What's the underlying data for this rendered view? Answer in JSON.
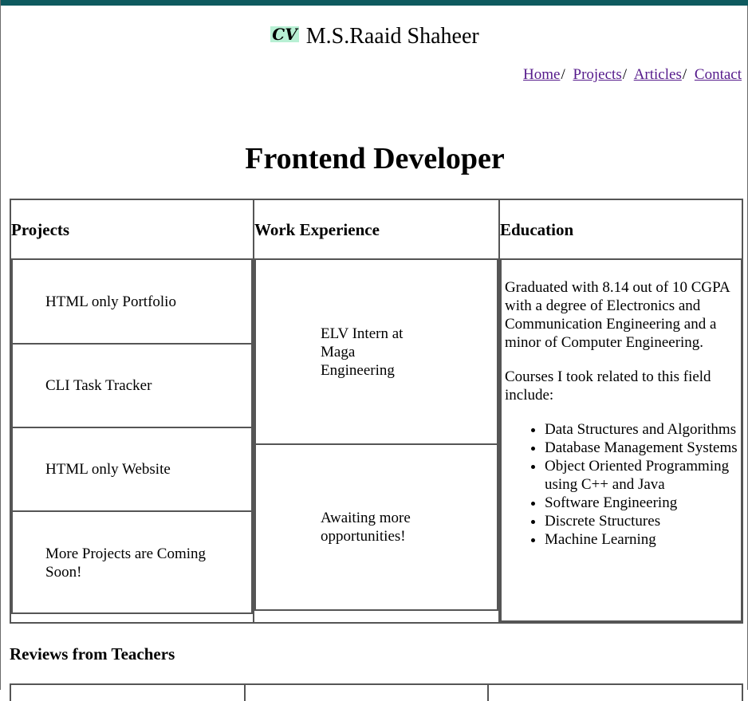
{
  "header": {
    "logo_text": "CV",
    "name": "M.S.Raaid Shaheer",
    "nav": [
      "Home",
      "Projects",
      "Articles",
      "Contact"
    ],
    "nav_separator": "/"
  },
  "title": "Frontend Developer",
  "columns": {
    "projects_heading": "Projects",
    "work_heading": "Work Experience",
    "education_heading": "Education"
  },
  "projects": [
    "HTML only Portfolio",
    "CLI Task Tracker",
    "HTML only Website",
    "More Projects are Coming Soon!"
  ],
  "work": [
    "ELV Intern at Maga Engineering",
    "Awaiting more opportunities!"
  ],
  "education": {
    "summary": "Graduated with 8.14 out of 10 CGPA with a degree of Electronics and Communication Engineering and a minor of Computer Engineering.",
    "courses_intro": "Courses I took related to this field include:",
    "courses": [
      "Data Structures and Algorithms",
      "Database Management Systems",
      "Object Oriented Programming using C++ and Java",
      "Software Engineering",
      "Discrete Structures",
      "Machine Learning"
    ]
  },
  "reviews_heading": "Reviews from Teachers",
  "colors": {
    "topbar": "#0e5a5f",
    "link": "#551a8b",
    "logo_bg": "#b8f0d4"
  }
}
